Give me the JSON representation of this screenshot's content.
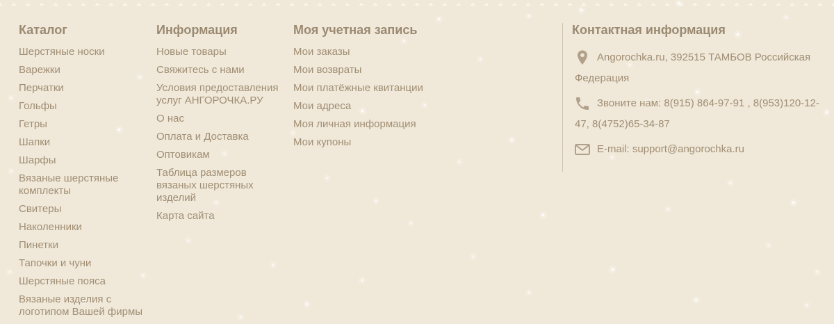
{
  "catalog": {
    "title": "Каталог",
    "items": [
      "Шерстяные носки",
      "Варежки",
      "Перчатки",
      "Гольфы",
      "Гетры",
      "Шапки",
      "Шарфы",
      "Вязаные шерстяные комплекты",
      "Свитеры",
      "Наколенники",
      "Пинетки",
      "Тапочки и чуни",
      "Шерстяные пояса",
      "Вязаные изделия с логотипом Вашей фирмы"
    ]
  },
  "information": {
    "title": "Информация",
    "items": [
      "Новые товары",
      "Свяжитесь с нами",
      "Условия предоставления услуг АНГОРОЧКА.РУ",
      "О нас",
      "Оплата и Доставка",
      "Оптовикам",
      "Таблица размеров вязаных шерстяных изделий",
      "Карта сайта"
    ]
  },
  "account": {
    "title": "Моя учетная запись",
    "items": [
      "Мои заказы",
      "Мои возвраты",
      "Мои платёжные квитанции",
      "Мои адреса",
      "Моя личная информация",
      "Мои купоны"
    ]
  },
  "contact": {
    "title": "Контактная информация",
    "address": "Angorochka.ru, 392515 ТАМБОВ Российская Федерация",
    "phone_label": "Звоните нам:",
    "phone": "8(915) 864-97-91 , 8(953)120-12-47, 8(4752)65-34-87",
    "email_label": "E-mail:",
    "email": "support@angorochka.ru"
  },
  "icons": {
    "address": "map-marker-icon",
    "phone": "phone-icon",
    "email": "envelope-icon"
  },
  "colors": {
    "background": "#f0e8d8",
    "heading": "#9b8a72",
    "link": "#a08e74"
  }
}
